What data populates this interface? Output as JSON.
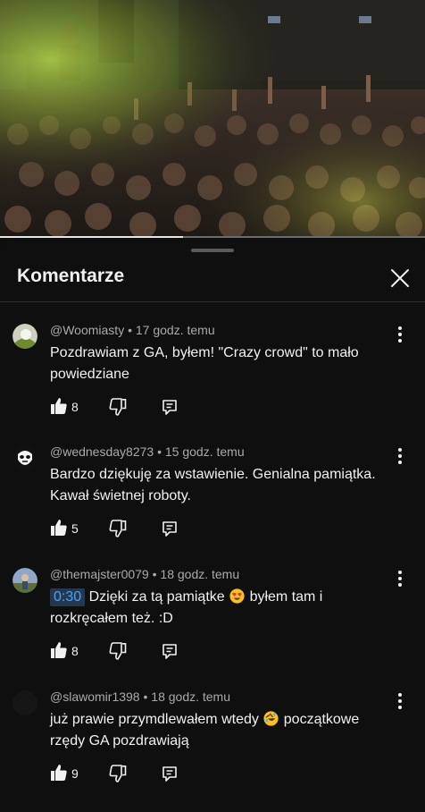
{
  "video": {
    "progress_fraction": 0.43
  },
  "comments_sheet": {
    "title": "Komentarze",
    "close_icon": "close-icon",
    "comments": [
      {
        "author": "@Woomiasty",
        "time": "17 godz. temu",
        "text": "Pozdrawiam z GA, byłem! \"Crazy crowd\" to mało powiedziane",
        "likes": "8"
      },
      {
        "author": "@wednesday8273",
        "time": "15 godz. temu",
        "text": "Bardzo dziękuję za wstawienie. Genialna pamiątka. Kawał świetnej roboty.",
        "likes": "5"
      },
      {
        "author": "@themajster0079",
        "time": "18 godz. temu",
        "timestamp": "0:30",
        "text_before": "Dzięki za tą pamiątke",
        "emoji": "heart-eyes-emoji",
        "text_after": "byłem tam i rozkręcałem też. :D",
        "likes": "8"
      },
      {
        "author": "@slawomir1398",
        "time": "18 godz. temu",
        "text_before": "już prawie przymdlewałem wtedy",
        "emoji": "rofl-emoji",
        "text_after": "początkowe rzędy GA pozdrawiają",
        "likes": "9"
      }
    ],
    "separator": "•"
  },
  "colors": {
    "background": "#0f0f0f",
    "text": "#f1f1f1",
    "meta_text": "#aaaaaa",
    "timestamp_link": "#3ea6ff",
    "stage_light_green": "#9acd32"
  }
}
